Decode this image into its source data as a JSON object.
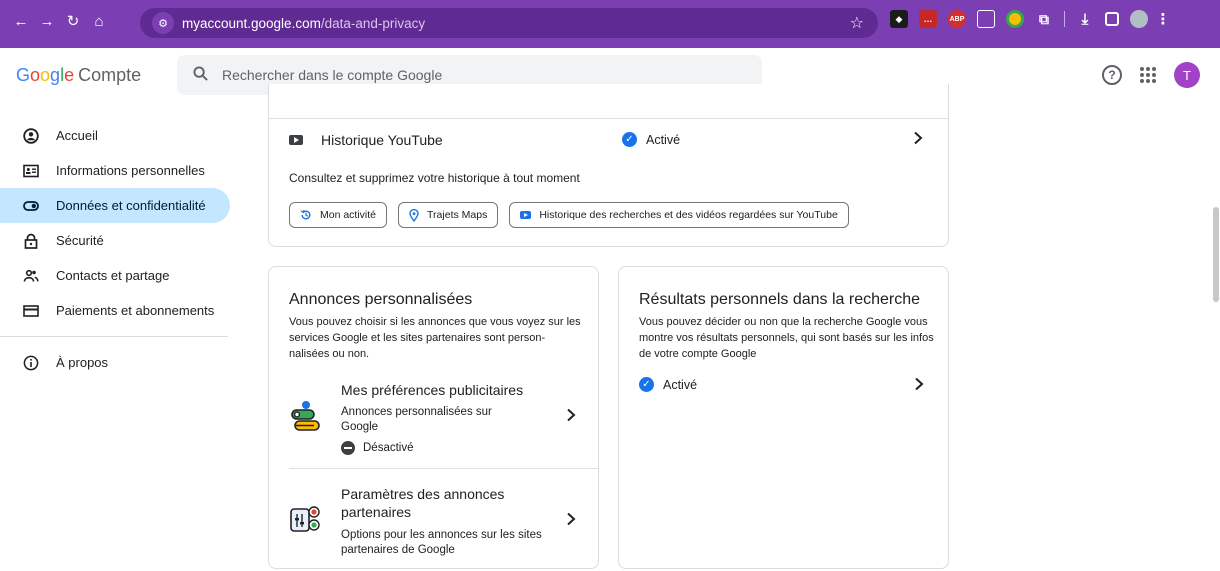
{
  "browser": {
    "url_host": "myaccount.google.com",
    "url_path": "/data-and-privacy"
  },
  "header": {
    "logo_letters": [
      "G",
      "o",
      "o",
      "g",
      "l",
      "e"
    ],
    "product": "Compte",
    "search_placeholder": "Rechercher dans le compte Google",
    "avatar_letter": "T"
  },
  "sidebar": {
    "items": [
      {
        "label": "Accueil",
        "icon": "account-circle-icon"
      },
      {
        "label": "Informations personnelles",
        "icon": "id-card-icon"
      },
      {
        "label": "Données et confidentialité",
        "icon": "toggle-icon",
        "active": true
      },
      {
        "label": "Sécurité",
        "icon": "lock-icon"
      },
      {
        "label": "Contacts et partage",
        "icon": "people-icon"
      },
      {
        "label": "Paiements et abonnements",
        "icon": "credit-card-icon"
      }
    ],
    "about": {
      "label": "À propos",
      "icon": "info-icon"
    }
  },
  "history_card": {
    "title": "Historique YouTube",
    "status": "Activé",
    "description": "Consultez et supprimez votre historique à tout moment",
    "chips": [
      {
        "label": "Mon activité",
        "icon": "history-icon"
      },
      {
        "label": "Trajets Maps",
        "icon": "map-pin-icon"
      },
      {
        "label": "Historique des recherches et des vidéos regardées sur YouTube",
        "icon": "youtube-icon"
      }
    ]
  },
  "ads_card": {
    "title": "Annonces personnalisées",
    "description": "Vous pouvez choisir si les annonces que vous voyez sur les services Google et les sites partenaires sont person-nalisées ou non.",
    "sub1": {
      "title": "Mes préférences publicitaires",
      "description": "Annonces personnalisées sur Google",
      "status": "Désactivé"
    },
    "sub2": {
      "title": "Paramètres des annonces partenaires",
      "description": "Options pour les annonces sur les sites partenaires de Google"
    }
  },
  "results_card": {
    "title": "Résultats personnels dans la recherche",
    "description": "Vous pouvez décider ou non que la recherche Google vous montre vos résultats personnels, qui sont basés sur les infos de votre compte Google",
    "status": "Activé"
  },
  "colors": {
    "chrome": "#7b3fb3",
    "active_nav": "#c2e7ff",
    "accent": "#1a73e8"
  }
}
